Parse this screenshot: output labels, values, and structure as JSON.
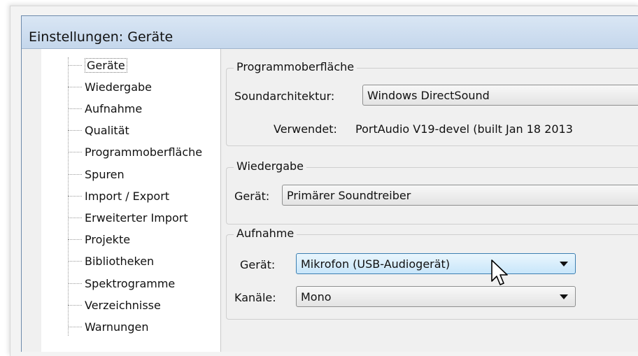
{
  "window": {
    "title": "Einstellungen: Geräte"
  },
  "tree": {
    "items": [
      {
        "label": "Geräte",
        "selected": true
      },
      {
        "label": "Wiedergabe"
      },
      {
        "label": "Aufnahme"
      },
      {
        "label": "Qualität"
      },
      {
        "label": "Programmoberfläche"
      },
      {
        "label": "Spuren"
      },
      {
        "label": "Import / Export"
      },
      {
        "label": "Erweiterter Import"
      },
      {
        "label": "Projekte"
      },
      {
        "label": "Bibliotheken"
      },
      {
        "label": "Spektrogramme"
      },
      {
        "label": "Verzeichnisse"
      },
      {
        "label": "Warnungen"
      }
    ]
  },
  "interface": {
    "legend": "Programmoberfläche",
    "host_label": "Soundarchitektur:",
    "host_value": "Windows DirectSound",
    "using_label": "Verwendet:",
    "using_value": "PortAudio V19-devel (built Jan 18 2013"
  },
  "playback": {
    "legend": "Wiedergabe",
    "device_label": "Gerät:",
    "device_value": "Primärer Soundtreiber"
  },
  "recording": {
    "legend": "Aufnahme",
    "device_label": "Gerät:",
    "device_value": "Mikrofon (USB-Audiogerät)",
    "channels_label": "Kanäle:",
    "channels_value": "Mono"
  },
  "icons": {
    "cursor": "mouse-pointer-icon",
    "dropdown": "chevron-down-icon"
  },
  "colors": {
    "titlebar": "#c5d7ec",
    "focus_border": "#3c7fb1",
    "focus_fill": "#c8e6fa"
  }
}
